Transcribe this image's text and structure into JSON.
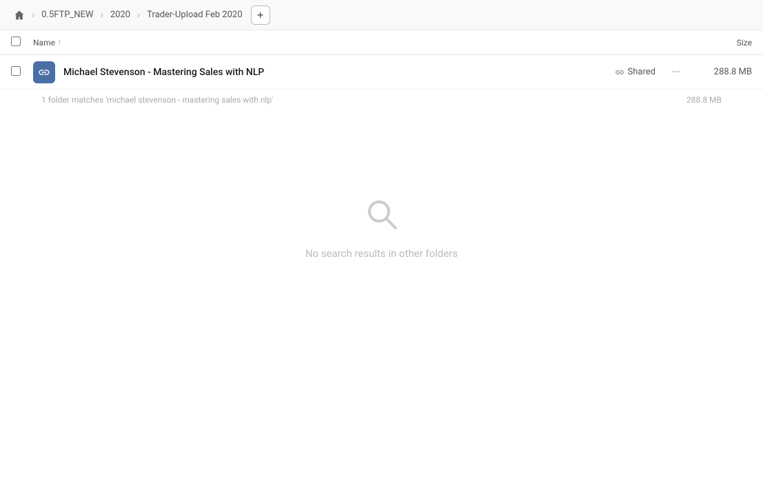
{
  "breadcrumb": {
    "home_label": "Home",
    "items": [
      {
        "label": "0.5FTP_NEW",
        "id": "breadcrumb-item-1"
      },
      {
        "label": "2020",
        "id": "breadcrumb-item-2"
      },
      {
        "label": "Trader-Upload Feb 2020",
        "id": "breadcrumb-item-3"
      }
    ],
    "add_button_label": "+"
  },
  "column_header": {
    "name_label": "Name",
    "sort_indicator": "↑",
    "size_label": "Size"
  },
  "file_row": {
    "icon_name": "link-icon",
    "name": "Michael Stevenson - Mastering Sales with NLP",
    "shared_label": "Shared",
    "more_label": "···",
    "size": "288.8 MB"
  },
  "match_info": {
    "text": "1 folder matches 'michael stevenson - mastering sales with nlp'",
    "size": "288.8 MB"
  },
  "empty_state": {
    "message": "No search results in other folders"
  }
}
